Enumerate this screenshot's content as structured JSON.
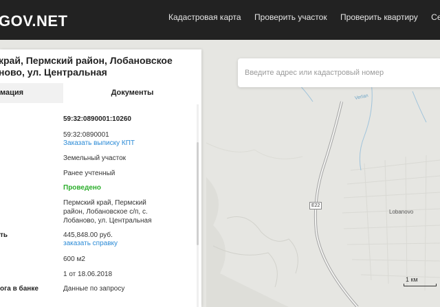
{
  "header": {
    "logo": "GOV.NET",
    "nav": [
      "Кадастровая карта",
      "Проверить участок",
      "Проверить квартиру",
      "Серв"
    ]
  },
  "search": {
    "placeholder": "Введите адрес или кадастровый номер"
  },
  "panel": {
    "title_lines": [
      "край, Пермский район, Лобановское",
      "ново, ул. Центральная"
    ],
    "tabs": [
      "мация",
      "Документы"
    ],
    "labels": {
      "value": "ть",
      "pledge": "ога в банке"
    },
    "values": {
      "cadastral_number": "59:32:0890001:10260",
      "quarter": "59:32:0890001",
      "order_kpt": "Заказать выписку КПТ",
      "type": "Земельный участок",
      "status": "Ранее учтенный",
      "survey": "Проведено",
      "address_lines": [
        "Пермский край, Пермский",
        "район, Лобановское с/п, с.",
        "Лобаново, ул. Центральная"
      ],
      "price": "445,848.00 руб.",
      "order_certificate": "заказать справку",
      "area": "600 м2",
      "date": "1 от 18.06.2018",
      "bank": "Данные по запросу"
    }
  },
  "map": {
    "road_badge": "E22",
    "town": "Lobanovo",
    "river": "Verlan",
    "scale": "1 км",
    "colors": {
      "land": "#e6e6e2",
      "river": "#9fc3db",
      "road": "#a3a3a3",
      "header": "#222222",
      "link": "#2a8ad6",
      "success": "#2cae2c"
    }
  }
}
